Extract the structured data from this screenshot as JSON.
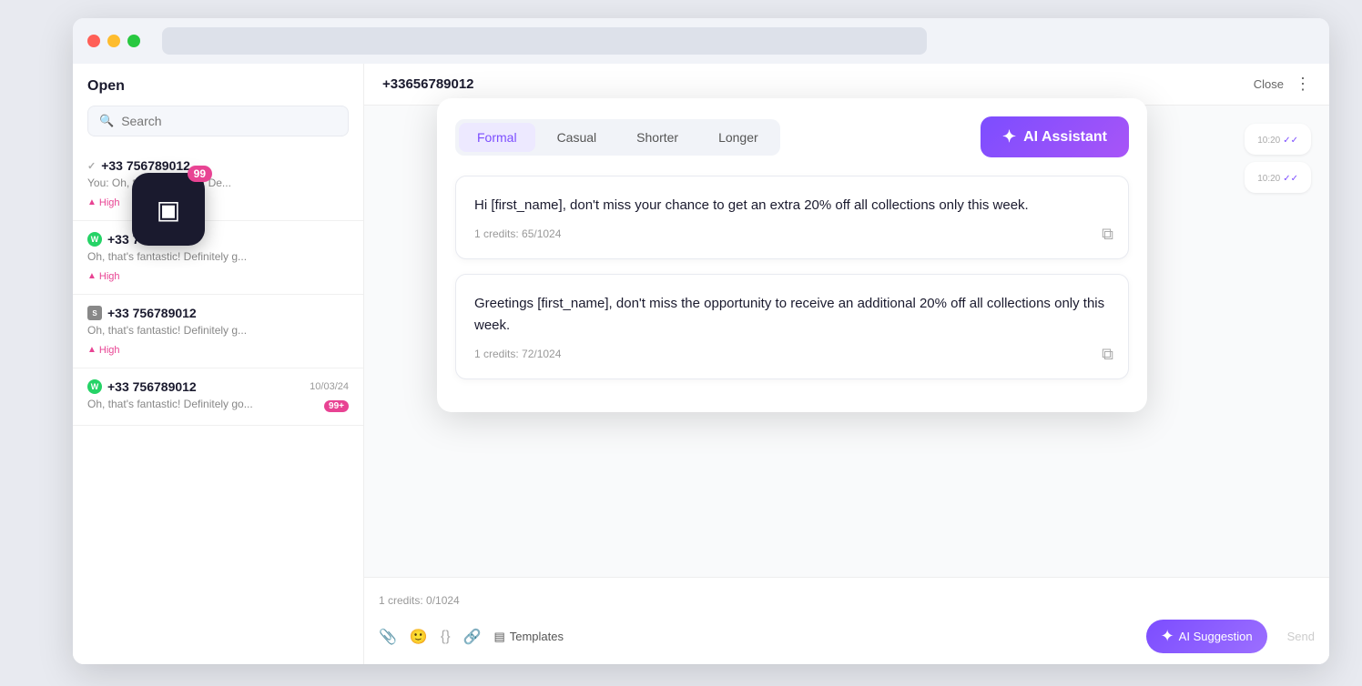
{
  "browser": {
    "url_bar": ""
  },
  "sidebar": {
    "title": "Open",
    "search_placeholder": "Search",
    "conversations": [
      {
        "phone": "+33 756789012",
        "preview": "You:  Oh, that's fantastic! De...",
        "priority": "High",
        "date": "",
        "channel": "check",
        "show_check": true
      },
      {
        "phone": "+33 756789012",
        "preview": "Oh, that's fantastic! Definitely g...",
        "priority": "High",
        "date": "",
        "channel": "whatsapp",
        "show_check": false
      },
      {
        "phone": "+33 756789012",
        "preview": "Oh, that's fantastic! Definitely g...",
        "priority": "High",
        "date": "",
        "channel": "sms",
        "show_check": false
      },
      {
        "phone": "+33 756789012",
        "preview": "Oh, that's fantastic! Definitely go...",
        "priority": "",
        "date": "10/03/24",
        "channel": "whatsapp",
        "badge": "99+",
        "show_check": false
      }
    ]
  },
  "chat": {
    "phone": "+33656789012",
    "close_label": "Close",
    "credits_label": "1 credits: 0/1024",
    "toolbar": {
      "attachment_label": "📎",
      "emoji_label": "😊",
      "code_label": "{}",
      "link_label": "🔗",
      "templates_label": "Templates",
      "ai_suggestion_label": "AI Suggestion",
      "send_label": "Send"
    },
    "messages": [
      {
        "time": "10:20",
        "checked": true
      },
      {
        "time": "10:20",
        "checked": true
      }
    ]
  },
  "ai_panel": {
    "title": "AI Assistant",
    "tones": [
      {
        "label": "Formal",
        "active": true
      },
      {
        "label": "Casual",
        "active": false
      },
      {
        "label": "Shorter",
        "active": false
      },
      {
        "label": "Longer",
        "active": false
      }
    ],
    "suggestions": [
      {
        "text": "Hi [first_name], don't miss your chance to get an extra 20% off all collections only this week.",
        "credits": "1 credits: 65/1024"
      },
      {
        "text": "Greetings [first_name], don't miss the opportunity to receive an additional 20% off all collections only this week.",
        "credits": "1 credits: 72/1024"
      }
    ]
  },
  "app_icon": {
    "badge": "99"
  }
}
